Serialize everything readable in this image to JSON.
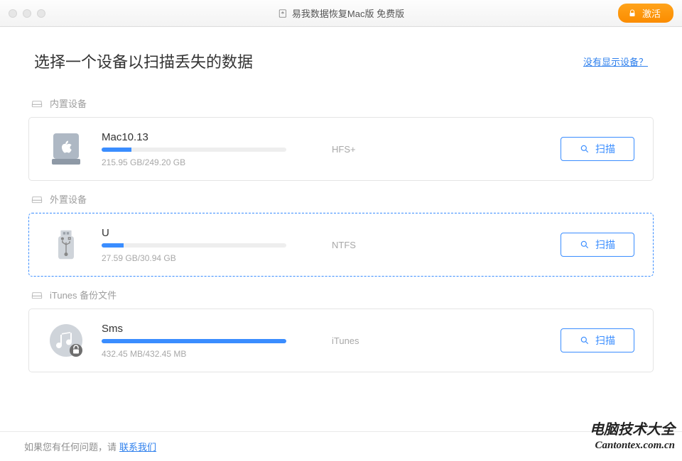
{
  "title_bar": {
    "app_title": "易我数据恢复Mac版 免费版",
    "activate_label": "激活"
  },
  "header": {
    "page_title": "选择一个设备以扫描丢失的数据",
    "no_device_link": "没有显示设备？"
  },
  "sections": {
    "internal": {
      "label": "内置设备"
    },
    "external": {
      "label": "外置设备"
    },
    "itunes": {
      "label": "iTunes 备份文件"
    }
  },
  "devices": {
    "internal": {
      "name": "Mac10.13",
      "size": "215.95 GB/249.20 GB",
      "fs": "HFS+",
      "progress_pct": 16,
      "scan_label": "扫描"
    },
    "external": {
      "name": "U",
      "size": "27.59 GB/30.94 GB",
      "fs": "NTFS",
      "progress_pct": 12,
      "scan_label": "扫描",
      "selected": true
    },
    "itunes": {
      "name": "Sms",
      "size": "432.45 MB/432.45 MB",
      "fs": "iTunes",
      "progress_pct": 100,
      "scan_label": "扫描"
    }
  },
  "footer": {
    "help_text": "如果您有任何问题，请",
    "contact_link": "联系我们"
  },
  "watermark": {
    "line1": "电脑技术大全",
    "line2": "Cantontex.com.cn"
  }
}
